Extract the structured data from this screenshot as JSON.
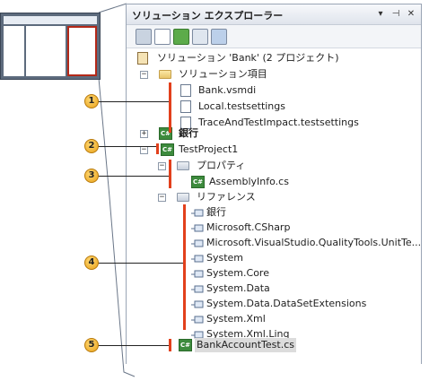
{
  "window": {
    "title": "ソリューション エクスプローラー",
    "buttons": [
      "▾",
      "⊣",
      "✕"
    ]
  },
  "toolbar": {
    "tools": [
      "properties-icon",
      "show-all-files-icon",
      "refresh-icon",
      "view-code-icon",
      "view-class-diagram-icon"
    ]
  },
  "tree": {
    "solution": "ソリューション 'Bank' (2 プロジェクト)",
    "solution_items": "ソリューション項目",
    "bank_vsmdi": "Bank.vsmdi",
    "local_testsettings": "Local.testsettings",
    "trace_testsettings": "TraceAndTestImpact.testsettings",
    "bank_project": "銀行",
    "test_project": "TestProject1",
    "properties": "プロパティ",
    "assembly_info": "AssemblyInfo.cs",
    "references": "リファレンス",
    "refs": [
      "銀行",
      "Microsoft.CSharp",
      "Microsoft.VisualStudio.QualityTools.UnitTe...",
      "System",
      "System.Core",
      "System.Data",
      "System.Data.DataSetExtensions",
      "System.Xml",
      "System.Xml.Linq"
    ],
    "bank_account_test": "BankAccountTest.cs"
  },
  "callouts": [
    "1",
    "2",
    "3",
    "4",
    "5"
  ],
  "colors": {
    "accent_red": "#e2401c",
    "callout": "#f2b233"
  }
}
